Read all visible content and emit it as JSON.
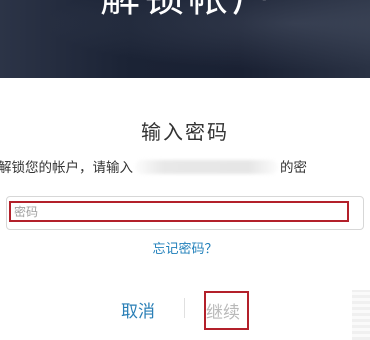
{
  "header": {
    "title": "解锁帐户"
  },
  "dialog": {
    "title": "输入密码",
    "message_start": "解锁您的帐户，请输入",
    "message_end": "的密",
    "password": {
      "placeholder": "密码",
      "value": ""
    },
    "forgot_link": "忘记密码？",
    "cancel_label": "取消",
    "continue_label": "继续"
  },
  "colors": {
    "link": "#2a7fb6",
    "highlight_border": "#b3202a",
    "disabled_text": "#b9b9b9"
  }
}
